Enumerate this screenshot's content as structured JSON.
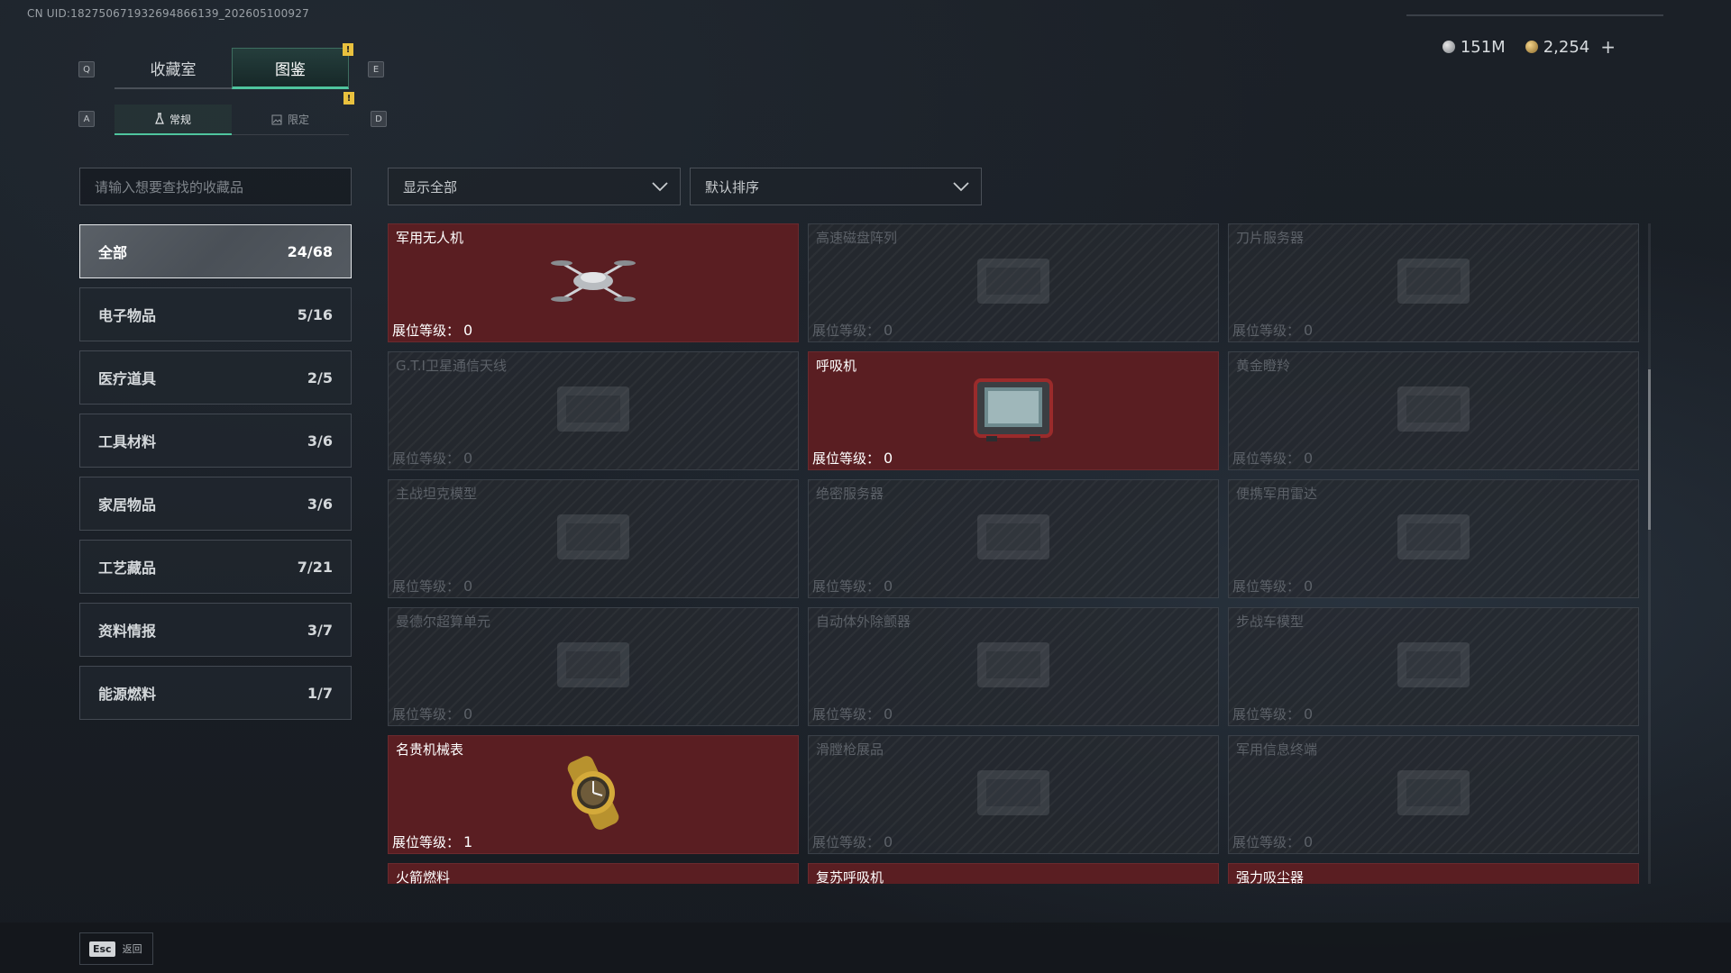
{
  "uid_text": "CN UID:18275067193269486613​9_202605100927",
  "currency": {
    "silver": "151M",
    "gold": "2,254",
    "plus": "+"
  },
  "keys": {
    "q": "Q",
    "e": "E",
    "a": "A",
    "d": "D"
  },
  "main_tabs": [
    {
      "label": "收藏室"
    },
    {
      "label": "图鉴",
      "badge": "!"
    }
  ],
  "sub_tabs": [
    {
      "label": "常规"
    },
    {
      "label": "限定",
      "badge": "!"
    }
  ],
  "search": {
    "placeholder": "请输入想要查找的收藏品"
  },
  "filter": {
    "value": "显示全部"
  },
  "sort": {
    "value": "默认排序"
  },
  "categories": [
    {
      "label": "全部",
      "count": "24/68"
    },
    {
      "label": "电子物品",
      "count": "5/16"
    },
    {
      "label": "医疗道具",
      "count": "2/5"
    },
    {
      "label": "工具材料",
      "count": "3/6"
    },
    {
      "label": "家居物品",
      "count": "3/6"
    },
    {
      "label": "工艺藏品",
      "count": "7/21"
    },
    {
      "label": "资料情报",
      "count": "3/7"
    },
    {
      "label": "能源燃料",
      "count": "1/7"
    }
  ],
  "level_label": "展位等级：",
  "items": [
    {
      "name": "军用无人机",
      "level": "0",
      "owned": true,
      "icon": "drone-icon"
    },
    {
      "name": "高速磁盘阵列",
      "level": "0",
      "owned": false,
      "icon": "disk-array-icon"
    },
    {
      "name": "刀片服务器",
      "level": "0",
      "owned": false,
      "icon": "blade-server-icon"
    },
    {
      "name": "G.T.I卫星通信天线",
      "level": "0",
      "owned": false,
      "icon": "satellite-dish-icon"
    },
    {
      "name": "呼吸机",
      "level": "0",
      "owned": true,
      "icon": "ventilator-icon"
    },
    {
      "name": "黄金瞪羚",
      "level": "0",
      "owned": false,
      "icon": "gold-gazelle-icon"
    },
    {
      "name": "主战坦克模型",
      "level": "0",
      "owned": false,
      "icon": "tank-model-icon"
    },
    {
      "name": "绝密服务器",
      "level": "0",
      "owned": false,
      "icon": "secret-server-icon"
    },
    {
      "name": "便携军用雷达",
      "level": "0",
      "owned": false,
      "icon": "radar-icon"
    },
    {
      "name": "曼德尔超算单元",
      "level": "0",
      "owned": false,
      "icon": "supercomputer-icon"
    },
    {
      "name": "自动体外除颤器",
      "level": "0",
      "owned": false,
      "icon": "defibrillator-icon"
    },
    {
      "name": "步战车模型",
      "level": "0",
      "owned": false,
      "icon": "ifv-model-icon"
    },
    {
      "name": "名贵机械表",
      "level": "1",
      "owned": true,
      "icon": "watch-icon"
    },
    {
      "name": "滑膛枪展品",
      "level": "0",
      "owned": false,
      "icon": "musket-icon"
    },
    {
      "name": "军用信息终端",
      "level": "0",
      "owned": false,
      "icon": "terminal-icon"
    },
    {
      "name": "火箭燃料",
      "level": "",
      "owned": true,
      "icon": "rocket-fuel-icon"
    },
    {
      "name": "复苏呼吸机",
      "level": "",
      "owned": true,
      "icon": "resuscitator-icon"
    },
    {
      "name": "强力吸尘器",
      "level": "",
      "owned": true,
      "icon": "vacuum-icon"
    }
  ],
  "footer": {
    "key": "Esc",
    "label": "返回"
  }
}
